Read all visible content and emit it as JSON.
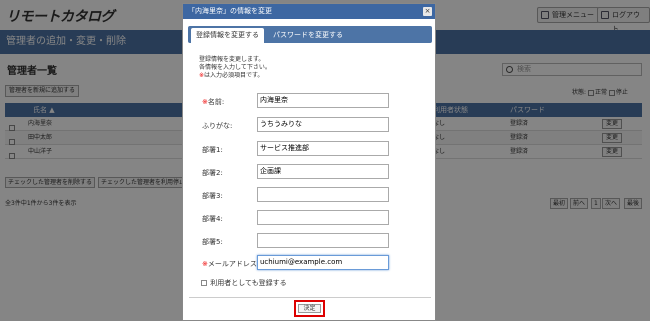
{
  "header": {
    "logo": "リモートカタログ",
    "admin_menu": "管理メニュー",
    "logout": "ログアウト"
  },
  "banner": {
    "title": "管理者の追加・変更・削除"
  },
  "page": {
    "title": "管理者一覧",
    "search_placeholder": "検索",
    "add_button": "管理者を新規に追加する",
    "status_label": "状態:",
    "status_active": "正常",
    "status_stopped": "停止"
  },
  "table": {
    "headers": {
      "name": "氏名",
      "status": "利用者状態",
      "password": "パスワード"
    },
    "sort_icon": "▲",
    "rows": [
      {
        "name": "内海里奈",
        "status": "なし",
        "password": "登録済",
        "action": "変更"
      },
      {
        "name": "田中太郎",
        "status": "なし",
        "password": "登録済",
        "action": "変更"
      },
      {
        "name": "中山洋子",
        "status": "なし",
        "password": "登録済",
        "action": "変更"
      }
    ]
  },
  "bulk": {
    "delete": "チェックした管理者を削除する",
    "stop": "チェックした管理者を利用停止"
  },
  "footer": {
    "count": "全3件中1件から3件を表示",
    "first": "最初",
    "prev": "前へ",
    "page": "1",
    "next": "次へ",
    "last": "最後"
  },
  "modal": {
    "title": "「内海里奈」の情報を変更",
    "close": "×",
    "tabs": {
      "active": "登録情報を変更する",
      "inactive": "パスワードを変更する"
    },
    "intro1": "登録情報を変更します。",
    "intro2": "各情報を入力して下さい。",
    "intro3_mark": "※",
    "intro3": "は入力必須項目です。",
    "fields": [
      {
        "label": "名前:",
        "value": "内海里奈",
        "required": true
      },
      {
        "label": "ふりがな:",
        "value": "うちうみりな",
        "required": false
      },
      {
        "label": "部署1:",
        "value": "サービス推進部",
        "required": false
      },
      {
        "label": "部署2:",
        "value": "企画課",
        "required": false
      },
      {
        "label": "部署3:",
        "value": "",
        "required": false
      },
      {
        "label": "部署4:",
        "value": "",
        "required": false
      },
      {
        "label": "部署5:",
        "value": "",
        "required": false
      },
      {
        "label": "メールアドレス:",
        "value": "uchiumi@example.com",
        "required": true
      }
    ],
    "req_mark": "※",
    "also_user": "利用者としても登録する",
    "submit": "決定"
  }
}
